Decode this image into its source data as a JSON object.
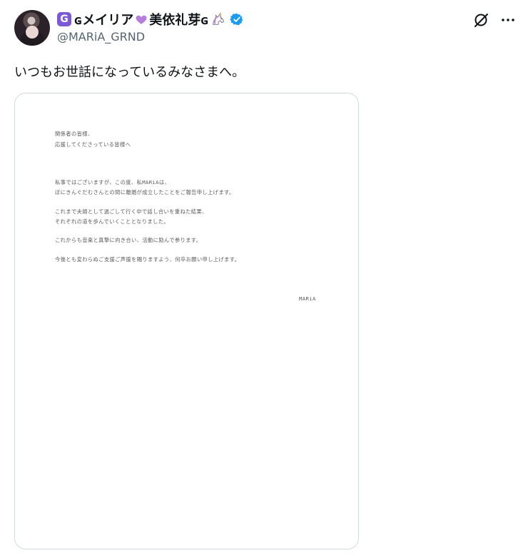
{
  "post": {
    "author": {
      "display_name": "ɢメイリア",
      "display_name_part2": "美依礼芽ɢ",
      "handle": "@MARiA_GRND",
      "badge_letter": "G",
      "verified": true
    },
    "text": "いつもお世話になっているみなさまへ。",
    "icons": {
      "avatar": "profile-avatar",
      "badge": "g-badge-icon",
      "heart": "purple-heart-icon",
      "unicorn": "unicorn-icon",
      "verified": "verified-badge-icon",
      "grok": "grok-icon",
      "more": "more-icon"
    },
    "colors": {
      "text": "#0f1419",
      "secondary_text": "#536471",
      "verified": "#1d9bf0",
      "badge": "#7c5ad6",
      "heart": "#b57edc",
      "border": "#cfd9de"
    }
  },
  "document": {
    "lines": [
      "関係者の皆様、",
      "応援してくださっている皆様へ",
      "私事ではございますが、この度、私MARiAは、",
      "ぼにきんぐだむさんとの間に離婚が成立したことをご報告申し上げます。",
      "これまで夫婦として過ごして行く中で話し合いを重ねた結果、",
      "それぞれの道を歩んでいくこととなりました。",
      "これからも音楽と真摯に向き合い、活動に励んで参ります。",
      "今後とも変わらぬご支援ご声援を賜りますよう、何卒お願い申し上げます。"
    ],
    "signature": "MARiA"
  }
}
